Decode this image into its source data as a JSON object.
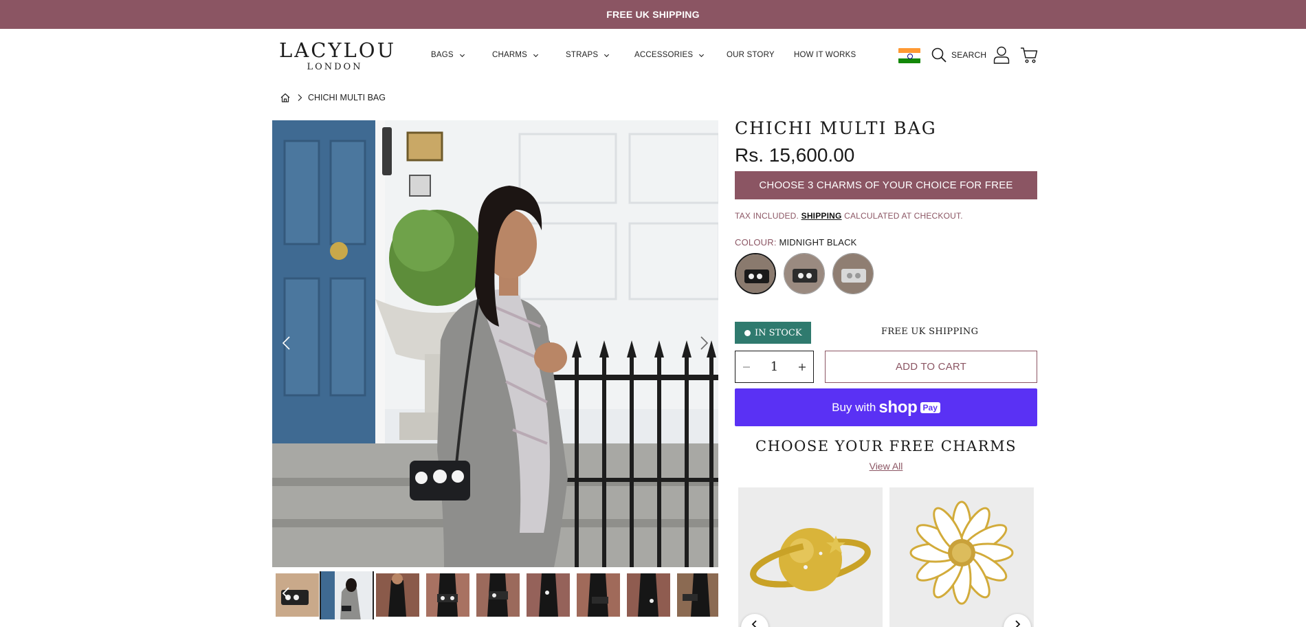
{
  "announcement": "FREE UK SHIPPING",
  "logo": {
    "line1": "LACYLOU",
    "line2": "LONDON"
  },
  "nav": {
    "bags": "BAGS",
    "charms": "CHARMS",
    "straps": "STRAPS",
    "accessories": "ACCESSORIES",
    "our_story": "OUR STORY",
    "how_it_works": "HOW IT WORKS"
  },
  "header": {
    "search_label": "SEARCH"
  },
  "breadcrumb": {
    "current": "CHICHI MULTI BAG"
  },
  "product": {
    "title": "CHICHI MULTI BAG",
    "price": "Rs. 15,600.00",
    "promo": "CHOOSE 3 CHARMS OF YOUR CHOICE FOR FREE",
    "tax_prefix": "TAX INCLUDED.",
    "tax_link": "SHIPPING",
    "tax_suffix": "CALCULATED AT CHECKOUT.",
    "colour_label": "COLOUR:",
    "colour_value": "MIDNIGHT BLACK",
    "stock": "IN STOCK",
    "shipping_note": "FREE UK SHIPPING",
    "quantity": "1",
    "add_to_cart": "ADD TO CART",
    "buy_with": "Buy with",
    "shop_word": "shop",
    "pay_word": "Pay"
  },
  "charms_section": {
    "title": "CHOOSE YOUR FREE CHARMS",
    "view_all": "View All"
  },
  "colors": {
    "brand": "#8b5563",
    "stock": "#2f7a6e",
    "shoppay": "#5a31f4"
  }
}
